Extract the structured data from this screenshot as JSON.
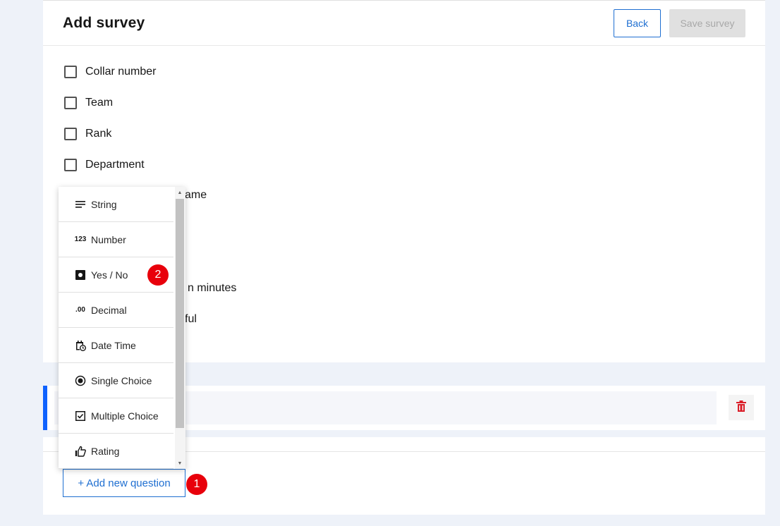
{
  "header": {
    "title": "Add survey",
    "back_label": "Back",
    "save_label": "Save survey"
  },
  "checkboxes": [
    {
      "label": "Collar number"
    },
    {
      "label": "Team"
    },
    {
      "label": "Rank"
    },
    {
      "label": "Department"
    }
  ],
  "hidden_fragments": {
    "frag1": "ame",
    "frag2": "n minutes",
    "frag3": "ful"
  },
  "dropdown": {
    "items": [
      {
        "label": "String",
        "icon": "lines-icon"
      },
      {
        "label": "Number",
        "icon": "number-icon",
        "glyph": "123"
      },
      {
        "label": "Yes / No",
        "icon": "toggle-square-icon"
      },
      {
        "label": "Decimal",
        "icon": "decimal-icon",
        "glyph": ".00"
      },
      {
        "label": "Date Time",
        "icon": "calendar-clock-icon"
      },
      {
        "label": "Single Choice",
        "icon": "radio-icon"
      },
      {
        "label": "Multiple Choice",
        "icon": "checkbox-icon"
      },
      {
        "label": "Rating",
        "icon": "thumbs-up-icon"
      }
    ]
  },
  "question": {
    "delete_icon": "trash-icon",
    "delete_color": "#da1e28"
  },
  "footer": {
    "add_label": "+ Add new question"
  },
  "annotations": {
    "badge1": "1",
    "badge2": "2"
  },
  "colors": {
    "accent": "#0f62fe",
    "link": "#1f6fd1",
    "badge": "#e8000b"
  }
}
